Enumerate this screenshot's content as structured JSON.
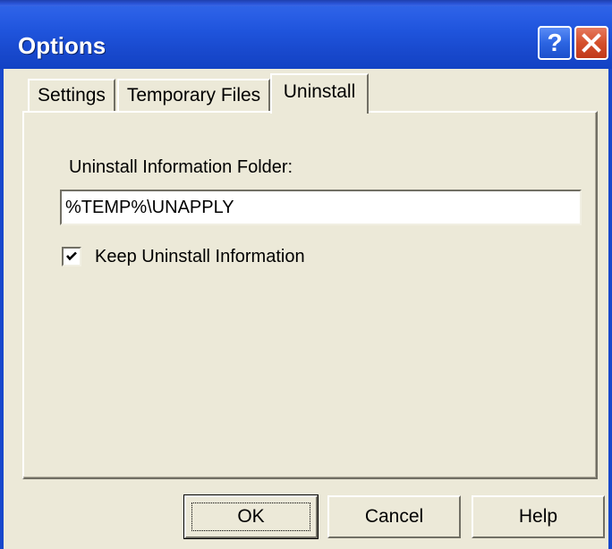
{
  "window": {
    "title": "Options",
    "help_label": "?",
    "close_icon": "close-x-icon",
    "titlebar_color": "#1848cc"
  },
  "tabs": [
    {
      "label": "Settings",
      "selected": false
    },
    {
      "label": "Temporary Files",
      "selected": false
    },
    {
      "label": "Uninstall",
      "selected": true
    }
  ],
  "uninstall": {
    "folder_label": "Uninstall Information Folder:",
    "folder_value": "%TEMP%\\UNAPPLY",
    "keep_checkbox_label": "Keep Uninstall Information",
    "keep_checked": true
  },
  "buttons": {
    "ok": "OK",
    "cancel": "Cancel",
    "help": "Help"
  }
}
